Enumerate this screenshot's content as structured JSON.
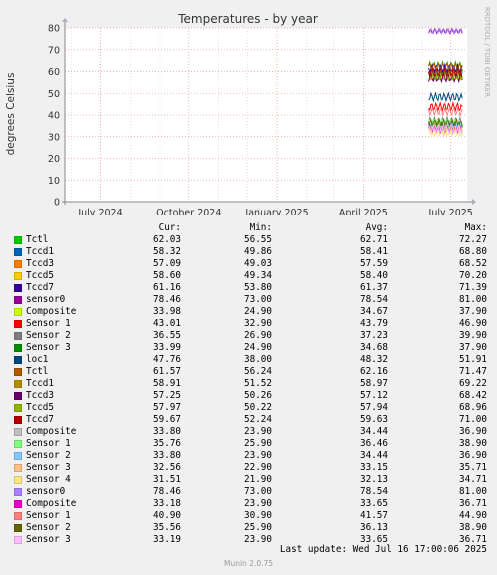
{
  "chart_data": {
    "type": "line",
    "title": "Temperatures - by year",
    "ylabel": "degrees Celsius",
    "ylim": [
      0,
      80
    ],
    "yticks": [
      0,
      10,
      20,
      30,
      40,
      50,
      60,
      70,
      80
    ],
    "xlim": [
      "2024-05-25",
      "2025-07-18"
    ],
    "xticks": [
      {
        "label": "July 2024",
        "date": "2024-07-01"
      },
      {
        "label": "October 2024",
        "date": "2024-10-01"
      },
      {
        "label": "January 2025",
        "date": "2025-01-01"
      },
      {
        "label": "April 2025",
        "date": "2025-04-01"
      },
      {
        "label": "July 2025",
        "date": "2025-07-01"
      }
    ],
    "data_start": "2025-06-08",
    "watermark": "RRDTOOL / TOBI OETIKER",
    "grid": true,
    "columns": [
      "Cur:",
      "Min:",
      "Avg:",
      "Max:"
    ],
    "series": [
      {
        "name": "Tctl",
        "color": "#00cc00",
        "cur": "62.03",
        "min": "56.55",
        "avg": "62.71",
        "max": "72.27"
      },
      {
        "name": "Tccd1",
        "color": "#0066b3",
        "cur": "58.32",
        "min": "49.86",
        "avg": "58.41",
        "max": "68.80"
      },
      {
        "name": "Tccd3",
        "color": "#ff8000",
        "cur": "57.09",
        "min": "49.03",
        "avg": "57.59",
        "max": "68.52"
      },
      {
        "name": "Tccd5",
        "color": "#ffcc00",
        "cur": "58.60",
        "min": "49.34",
        "avg": "58.40",
        "max": "70.20"
      },
      {
        "name": "Tccd7",
        "color": "#330099",
        "cur": "61.16",
        "min": "53.80",
        "avg": "61.37",
        "max": "71.39"
      },
      {
        "name": "sensor0",
        "color": "#990099",
        "cur": "78.46",
        "min": "73.00",
        "avg": "78.54",
        "max": "81.00"
      },
      {
        "name": "Composite",
        "color": "#ccff00",
        "cur": "33.98",
        "min": "24.90",
        "avg": "34.67",
        "max": "37.90"
      },
      {
        "name": "Sensor 1",
        "color": "#ff0000",
        "cur": "43.01",
        "min": "32.90",
        "avg": "43.79",
        "max": "46.90"
      },
      {
        "name": "Sensor 2",
        "color": "#808080",
        "cur": "36.55",
        "min": "26.90",
        "avg": "37.23",
        "max": "39.90"
      },
      {
        "name": "Sensor 3",
        "color": "#008f00",
        "cur": "33.99",
        "min": "24.90",
        "avg": "34.68",
        "max": "37.90"
      },
      {
        "name": "loc1",
        "color": "#00487d",
        "cur": "47.76",
        "min": "38.00",
        "avg": "48.32",
        "max": "51.91"
      },
      {
        "name": "Tctl",
        "color": "#b35a00",
        "cur": "61.57",
        "min": "56.24",
        "avg": "62.16",
        "max": "71.47"
      },
      {
        "name": "Tccd1",
        "color": "#b38f00",
        "cur": "58.91",
        "min": "51.52",
        "avg": "58.97",
        "max": "69.22"
      },
      {
        "name": "Tccd3",
        "color": "#6b006b",
        "cur": "57.25",
        "min": "50.26",
        "avg": "57.12",
        "max": "68.42"
      },
      {
        "name": "Tccd5",
        "color": "#8fb300",
        "cur": "57.97",
        "min": "50.22",
        "avg": "57.94",
        "max": "68.96"
      },
      {
        "name": "Tccd7",
        "color": "#b30000",
        "cur": "59.67",
        "min": "52.24",
        "avg": "59.63",
        "max": "71.00"
      },
      {
        "name": "Composite",
        "color": "#bebebe",
        "cur": "33.80",
        "min": "23.90",
        "avg": "34.44",
        "max": "36.90"
      },
      {
        "name": "Sensor 1",
        "color": "#80ff80",
        "cur": "35.76",
        "min": "25.90",
        "avg": "36.46",
        "max": "38.90"
      },
      {
        "name": "Sensor 2",
        "color": "#80c9ff",
        "cur": "33.80",
        "min": "23.90",
        "avg": "34.44",
        "max": "36.90"
      },
      {
        "name": "Sensor 3",
        "color": "#ffc080",
        "cur": "32.56",
        "min": "22.90",
        "avg": "33.15",
        "max": "35.71"
      },
      {
        "name": "Sensor 4",
        "color": "#ffe680",
        "cur": "31.51",
        "min": "21.90",
        "avg": "32.13",
        "max": "34.71"
      },
      {
        "name": "sensor0",
        "color": "#aa80ff",
        "cur": "78.46",
        "min": "73.00",
        "avg": "78.54",
        "max": "81.00"
      },
      {
        "name": "Composite",
        "color": "#ee00cc",
        "cur": "33.18",
        "min": "23.90",
        "avg": "33.65",
        "max": "36.71"
      },
      {
        "name": "Sensor 1",
        "color": "#ff8080",
        "cur": "40.90",
        "min": "30.90",
        "avg": "41.57",
        "max": "44.90"
      },
      {
        "name": "Sensor 2",
        "color": "#666600",
        "cur": "35.56",
        "min": "25.90",
        "avg": "36.13",
        "max": "38.90"
      },
      {
        "name": "Sensor 3",
        "color": "#ffbfff",
        "cur": "33.19",
        "min": "23.90",
        "avg": "33.65",
        "max": "36.71"
      }
    ]
  },
  "footer": {
    "last_update": "Last update: Wed Jul 16 17:00:06 2025",
    "version": "Munin 2.0.75"
  }
}
